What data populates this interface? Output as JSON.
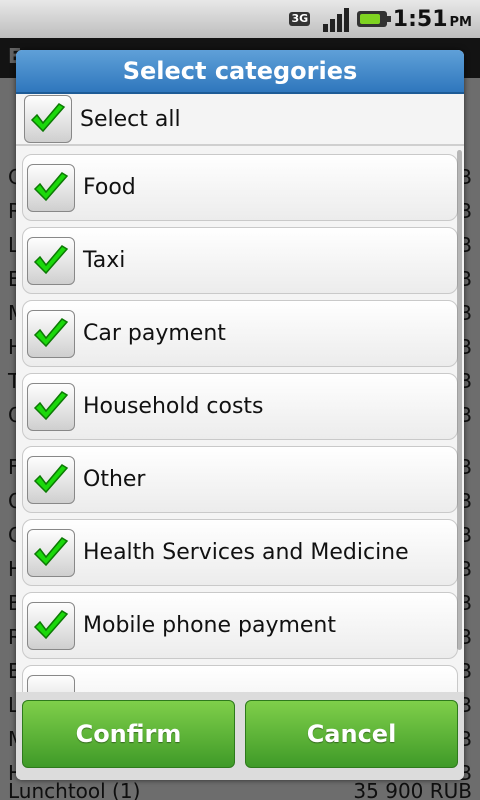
{
  "statusbar": {
    "network": "3G",
    "time": "1:51",
    "ampm": "PM"
  },
  "background": {
    "title": "E",
    "rows": [
      {
        "left": "C",
        "right": "B"
      },
      {
        "left": "R",
        "right": "B"
      },
      {
        "left": "L",
        "right": "B"
      },
      {
        "left": "E",
        "right": "B"
      },
      {
        "left": "M",
        "right": "B"
      },
      {
        "left": "H",
        "right": "B"
      },
      {
        "left": "T",
        "right": "B"
      },
      {
        "left": "O",
        "right": "B"
      },
      {
        "left": "F",
        "right": "B"
      },
      {
        "left": "O",
        "right": "B"
      },
      {
        "left": "C",
        "right": "B"
      },
      {
        "left": "H",
        "right": "B"
      },
      {
        "left": "B",
        "right": "B"
      },
      {
        "left": "R",
        "right": "B"
      },
      {
        "left": "E",
        "right": "B"
      },
      {
        "left": "L",
        "right": "B"
      },
      {
        "left": "M",
        "right": "B"
      },
      {
        "left": "H",
        "right": "B"
      },
      {
        "left": "Lunchtool (1)",
        "right": "35 900 RUB"
      }
    ]
  },
  "dialog": {
    "title": "Select categories",
    "select_all": "Select all",
    "items": [
      {
        "label": "Food"
      },
      {
        "label": "Taxi"
      },
      {
        "label": "Car payment"
      },
      {
        "label": "Household costs"
      },
      {
        "label": "Other"
      },
      {
        "label": "Health Services and Medicine"
      },
      {
        "label": "Mobile phone payment"
      },
      {
        "label": ""
      }
    ],
    "confirm": "Confirm",
    "cancel": "Cancel"
  },
  "colors": {
    "accent_blue": "#2f77bd",
    "button_green": "#4aa82f",
    "check_green": "#1bd80b"
  }
}
